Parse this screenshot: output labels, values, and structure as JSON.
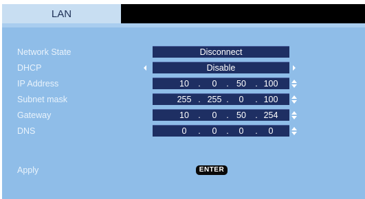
{
  "tabs": [
    {
      "label": "LAN",
      "active": true
    }
  ],
  "form": {
    "network_state": {
      "label": "Network State",
      "value": "Disconnect"
    },
    "dhcp": {
      "label": "DHCP",
      "value": "Disable"
    },
    "ip_address": {
      "label": "IP Address",
      "octets": [
        "10",
        "0",
        "50",
        "100"
      ]
    },
    "subnet_mask": {
      "label": "Subnet mask",
      "octets": [
        "255",
        "255",
        "0",
        "100"
      ]
    },
    "gateway": {
      "label": "Gateway",
      "octets": [
        "10",
        "0",
        "50",
        "254"
      ]
    },
    "dns": {
      "label": "DNS",
      "octets": [
        "0",
        "0",
        "0",
        "0"
      ]
    },
    "ip_separator": ".",
    "apply": {
      "label": "Apply",
      "button_label": "ENTER"
    }
  },
  "colors": {
    "panel": "#8fbde8",
    "tab_active": "#c8def2",
    "value_box": "#1e2f63",
    "tab_bar": "#000000"
  }
}
